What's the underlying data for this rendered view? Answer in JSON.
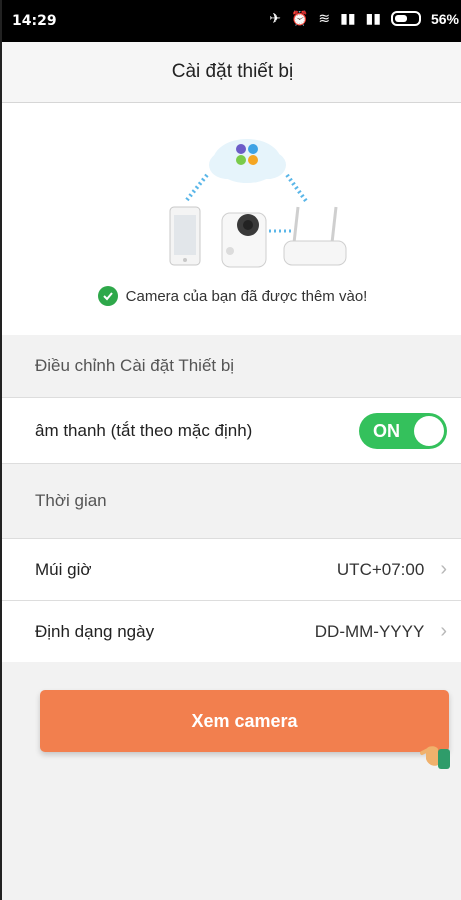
{
  "status_bar": {
    "time": "14:29",
    "battery": "56%"
  },
  "header": {
    "title": "Cài đặt thiết bị"
  },
  "hero": {
    "success_message": "Camera của bạn đã được thêm vào!"
  },
  "sections": {
    "device_settings": "Điều chỉnh Cài đặt Thiết bị",
    "time": "Thời gian"
  },
  "rows": {
    "sound": {
      "label": "âm thanh (tắt theo mặc định)",
      "toggle_text": "ON",
      "toggle_on": true
    },
    "timezone": {
      "label": "Múi giờ",
      "value": "UTC+07:00"
    },
    "date_format": {
      "label": "Định dạng ngày",
      "value": "DD-MM-YYYY"
    }
  },
  "buttons": {
    "view_camera": "Xem camera"
  },
  "colors": {
    "toggle_green": "#34c15c",
    "cta_orange": "#f27f4e",
    "success_green": "#2ea84a"
  }
}
